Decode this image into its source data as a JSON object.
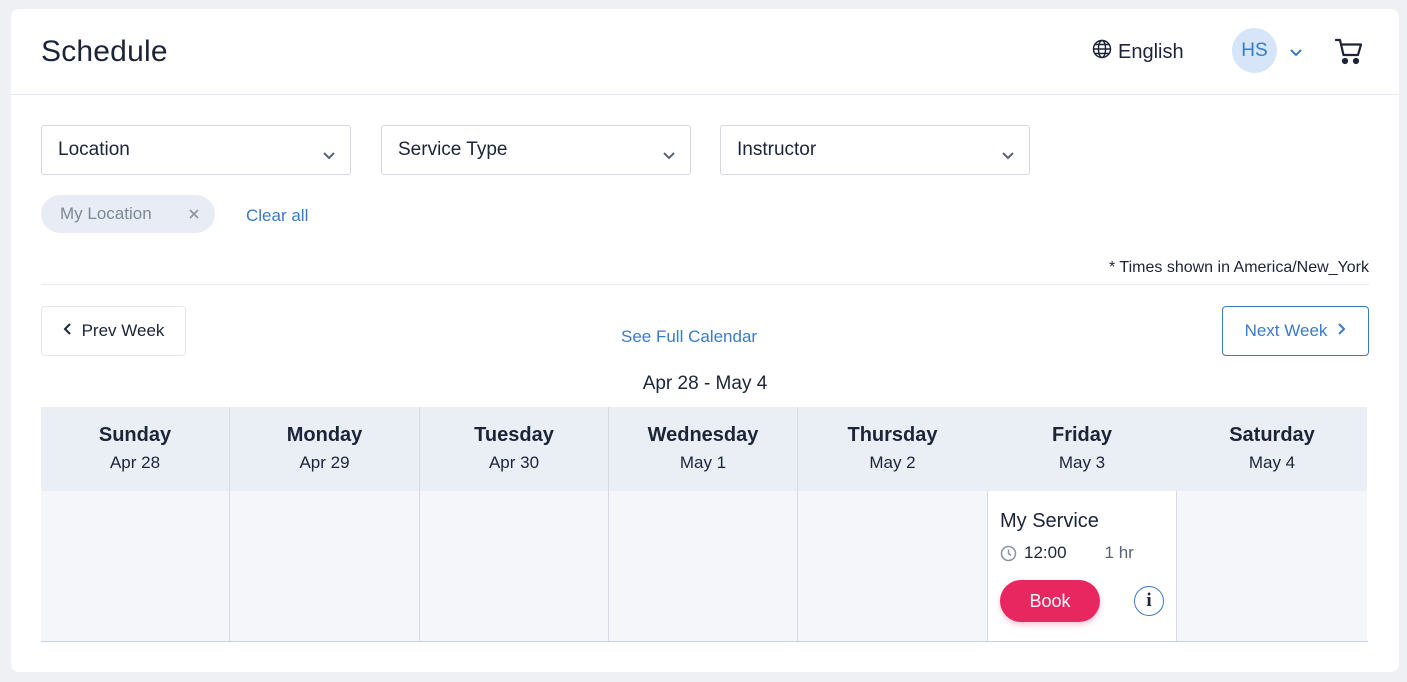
{
  "header": {
    "title": "Schedule",
    "language": "English",
    "avatar_initials": "HS"
  },
  "filters": [
    {
      "label": "Location"
    },
    {
      "label": "Service Type"
    },
    {
      "label": "Instructor"
    }
  ],
  "active_filters": {
    "chip_label": "My Location",
    "clear_all": "Clear all"
  },
  "timezone_note": "* Times shown in America/New_York",
  "nav": {
    "prev_week": "Prev Week",
    "next_week": "Next Week",
    "full_calendar": "See Full Calendar",
    "week_range": "Apr 28 - May 4"
  },
  "days": [
    {
      "day": "Sunday",
      "date": "Apr 28"
    },
    {
      "day": "Monday",
      "date": "Apr 29"
    },
    {
      "day": "Tuesday",
      "date": "Apr 30"
    },
    {
      "day": "Wednesday",
      "date": "May 1"
    },
    {
      "day": "Thursday",
      "date": "May 2"
    },
    {
      "day": "Friday",
      "date": "May 3"
    },
    {
      "day": "Saturday",
      "date": "May 4"
    }
  ],
  "event": {
    "title": "My Service",
    "time": "12:00",
    "duration": "1 hr",
    "book_label": "Book",
    "info_icon_glyph": "i"
  },
  "colors": {
    "accent": "#3a7bc8",
    "book": "#e8265f",
    "header_bg": "#eaeff6"
  }
}
